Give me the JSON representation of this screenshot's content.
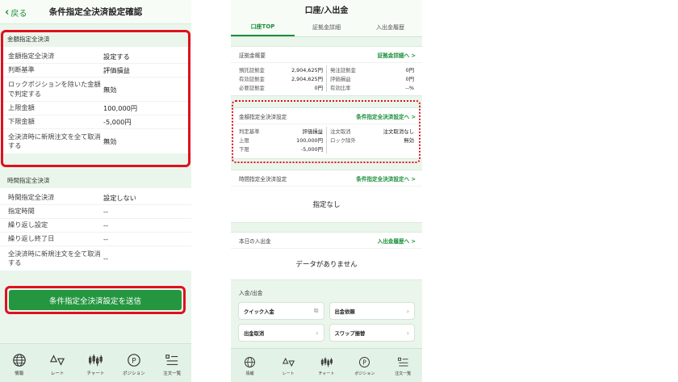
{
  "left": {
    "back_label": "戻る",
    "title": "条件指定全決済設定確認",
    "amount_section": {
      "heading": "金額指定全決済",
      "rows": [
        {
          "k": "金額指定全決済",
          "v": "設定する"
        },
        {
          "k": "判断基準",
          "v": "評価損益"
        },
        {
          "k": "ロックポジションを除いた金額で判定する",
          "v": "無効"
        },
        {
          "k": "上限金額",
          "v": "100,000円"
        },
        {
          "k": "下限金額",
          "v": "-5,000円"
        },
        {
          "k": "全決済時に新規注文を全て取消する",
          "v": "無効"
        }
      ]
    },
    "time_section": {
      "heading": "時間指定全決済",
      "rows": [
        {
          "k": "時間指定全決済",
          "v": "設定しない"
        },
        {
          "k": "指定時間",
          "v": "--"
        },
        {
          "k": "繰り返し設定",
          "v": "--"
        },
        {
          "k": "繰り返し終了日",
          "v": "--"
        },
        {
          "k": "全決済時に新規注文を全て取消する",
          "v": "--"
        }
      ]
    },
    "submit_label": "条件指定全決済設定を送信"
  },
  "right": {
    "title": "口座/入出金",
    "tabs": [
      "口座TOP",
      "証拠金詳細",
      "入出金履歴"
    ],
    "margin": {
      "heading": "証拠金概要",
      "link": "証拠金詳細へ >",
      "left_col": [
        {
          "k": "預託証拠金",
          "v": "2,904,625円"
        },
        {
          "k": "有効証拠金",
          "v": "2,904,625円"
        },
        {
          "k": "必要証拠金",
          "v": "0円"
        }
      ],
      "right_col": [
        {
          "k": "発注証拠金",
          "v": "0円"
        },
        {
          "k": "評価損益",
          "v": "0円"
        },
        {
          "k": "有効比率",
          "v": "--%"
        }
      ]
    },
    "amount_setting": {
      "heading": "金額指定全決済設定",
      "link": "条件指定全決済設定へ >",
      "left_col": [
        {
          "k": "判定基準",
          "v": "評価損益"
        },
        {
          "k": "上限",
          "v": "100,000円"
        },
        {
          "k": "下限",
          "v": "-5,000円"
        }
      ],
      "right_col": [
        {
          "k": "注文取消",
          "v": "注文取消なし"
        },
        {
          "k": "ロック除外",
          "v": "無効"
        }
      ]
    },
    "time_setting": {
      "heading": "時間指定全決済設定",
      "link": "条件指定全決済設定へ >",
      "message": "指定なし"
    },
    "today_deposit": {
      "heading": "本日の入出金",
      "link": "入出金履歴へ >",
      "message": "データがありません"
    },
    "deposit_withdraw": {
      "heading": "入金/出金",
      "buttons": [
        "クイック入金",
        "出金依頼",
        "出金取消",
        "スワップ振替"
      ]
    }
  },
  "tabbar": [
    "情報",
    "レート",
    "チャート",
    "ポジション",
    "注文一覧"
  ],
  "colors": {
    "accent": "#23963f",
    "highlight": "#e0101e",
    "background": "#eaf6ec"
  }
}
